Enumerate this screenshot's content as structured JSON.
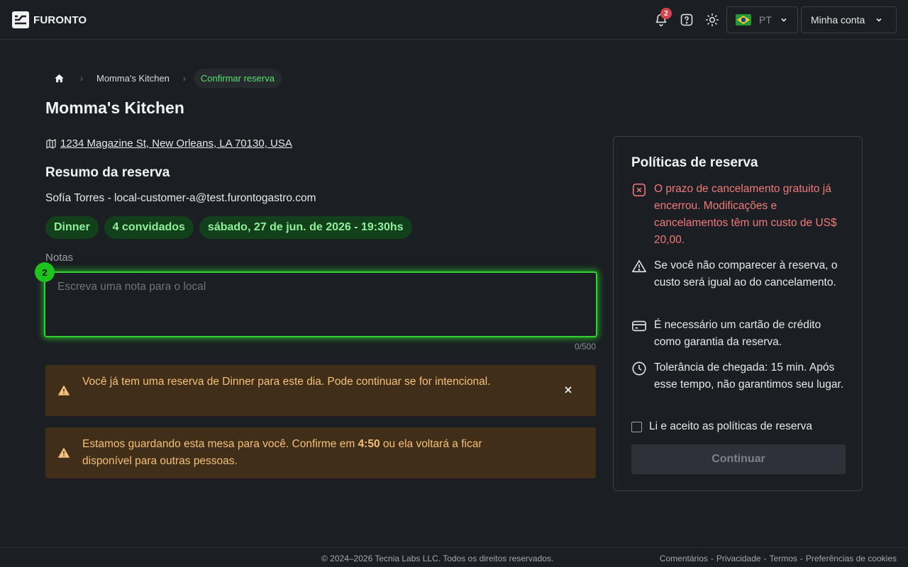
{
  "header": {
    "logo_text": "FURONTO",
    "notifications_count": "2",
    "language": "PT",
    "account_label": "Minha conta",
    "accent_color": "#57e06b"
  },
  "breadcrumb": {
    "items": [
      "Momma's Kitchen",
      "Confirmar reserva"
    ]
  },
  "restaurant": {
    "name": "Momma's Kitchen",
    "address": "1234 Magazine St, New Orleans, LA 70130, USA"
  },
  "summary": {
    "title": "Resumo da reserva",
    "customer": "Sofía Torres - local-customer-a@test.furontogastro.com",
    "chips": [
      "Dinner",
      "4 convidados",
      "sábado, 27 de jun. de 2026 - 19:30hs"
    ]
  },
  "notes": {
    "label": "Notas",
    "placeholder": "Escreva uma nota para o local",
    "value": "",
    "counter": "0/500",
    "step_badge": "2"
  },
  "alerts": {
    "duplicate": "Você já tem uma reserva de Dinner para este dia. Pode continuar se for intencional.",
    "hold_before": "Estamos guardando esta mesa para você. Confirme em ",
    "hold_time": "4:50",
    "hold_after": " ou ela voltará a ficar disponível para outras pessoas."
  },
  "policies": {
    "title": "Políticas de reserva",
    "items": [
      "O prazo de cancelamento gratuito já encerrou. Modificações e cancelamentos têm um custo de US$ 20,00.",
      "Se você não comparecer à reserva, o custo será igual ao do cancelamento.",
      "É necessário um cartão de crédito como garantia da reserva.",
      "Tolerância de chegada: 15 min. Após esse tempo, não garantimos seu lugar."
    ],
    "accept_label": "Li e aceito as políticas de reserva",
    "continue_label": "Continuar"
  },
  "footer": {
    "copyright": "© 2024–2026 Tecnia Labs LLC. Todos os direitos reservados.",
    "links": [
      "Comentários",
      "Privacidade",
      "Termos",
      "Preferências de cookies"
    ],
    "separator": "-"
  }
}
